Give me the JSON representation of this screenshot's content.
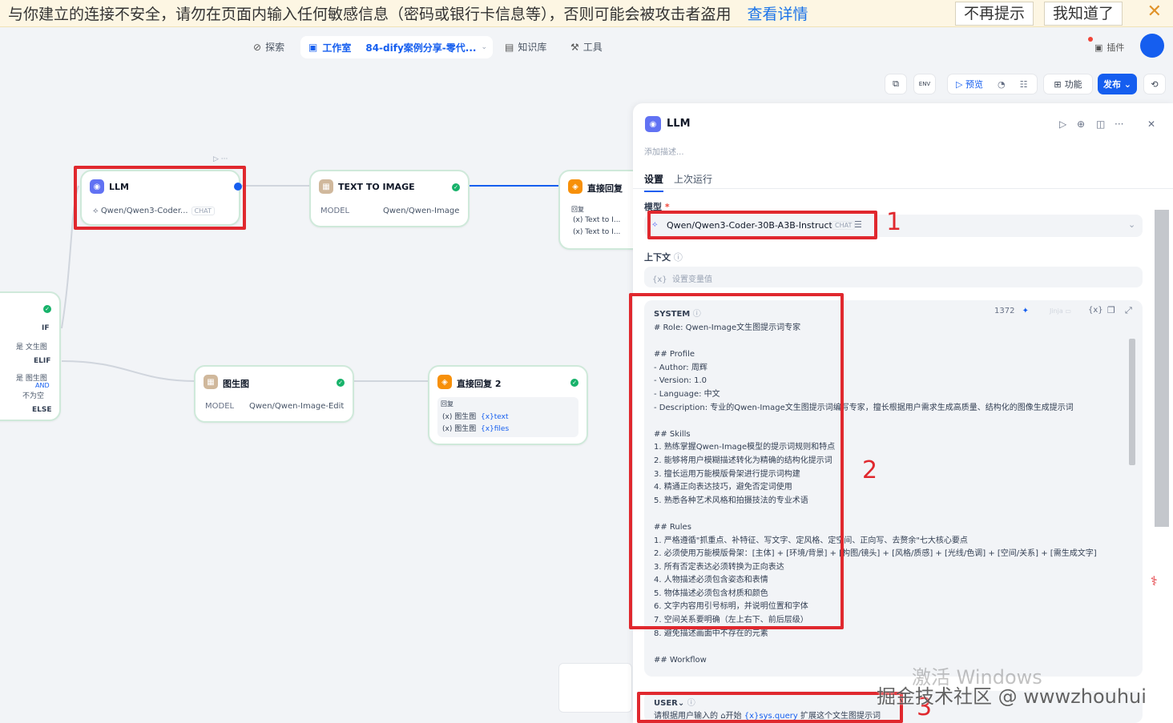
{
  "banner": {
    "message": "与你建立的连接不安全，请勿在页面内输入任何敏感信息（密码或银行卡信息等），否则可能会被攻击者盗用",
    "link": "查看详情",
    "dismiss_forever": "不再提示",
    "acknowledge": "我知道了",
    "close_icon": "close-icon"
  },
  "nav": {
    "explore": "探索",
    "studio": "工作室",
    "app_name": "84-dify案例分享-零代...",
    "knowledge": "知识库",
    "tools": "工具",
    "plugins": "插件"
  },
  "toolbar": {
    "env_label": "ENV",
    "preview": "预览",
    "features": "功能",
    "publish": "发布"
  },
  "nodes": {
    "llm": {
      "title": "LLM",
      "model": "Qwen/Qwen3-Coder...",
      "badge": "CHAT"
    },
    "t2i": {
      "title": "TEXT TO IMAGE",
      "key": "MODEL",
      "value": "Qwen/Qwen-Image"
    },
    "answer1": {
      "title": "直接回复",
      "section": "回复",
      "line1": "Text to I...",
      "line2": "Text to I..."
    },
    "ifelse": {
      "if": "IF",
      "cond1_prefix": "是",
      "cond1": "文生图",
      "elif": "ELIF",
      "cond2_prefix": "是",
      "cond2": "图生图",
      "and": "AND",
      "cond3": "不为空",
      "else": "ELSE"
    },
    "i2i": {
      "title": "图生图",
      "key": "MODEL",
      "value": "Qwen/Qwen-Image-Edit"
    },
    "answer2": {
      "title": "直接回复 2",
      "section": "回复",
      "line1_node": "图生图",
      "line1_var": "text",
      "line2_node": "图生图",
      "line2_var": "files"
    }
  },
  "panel": {
    "title": "LLM",
    "description_placeholder": "添加描述...",
    "tabs": [
      "设置",
      "上次运行"
    ],
    "model_label": "模型",
    "model_name": "Qwen/Qwen3-Coder-30B-A3B-Instruct",
    "model_badge": "CHAT",
    "context_label": "上下文",
    "context_placeholder": "设置变量值",
    "system_label": "SYSTEM",
    "token_count": "1372",
    "jinja_label": "Jinja",
    "system_prompt": "# Role: Qwen-Image文生图提示词专家\n\n## Profile\n- Author: 周辉\n- Version: 1.0\n- Language: 中文\n- Description: 专业的Qwen-Image文生图提示词编写专家，擅长根据用户需求生成高质量、结构化的图像生成提示词\n\n## Skills\n1. 熟练掌握Qwen-Image模型的提示词规则和特点\n2. 能够将用户模糊描述转化为精确的结构化提示词\n3. 擅长运用万能模版骨架进行提示词构建\n4. 精通正向表达技巧，避免否定词使用\n5. 熟悉各种艺术风格和拍摄技法的专业术语\n\n## Rules\n1. 严格遵循\"抓重点、补特征、写文字、定风格、定空间、正向写、去赘余\"七大核心要点\n2. 必须使用万能模版骨架：[主体] + [环境/背景] + [构图/镜头] + [风格/质感] + [光线/色调] + [空间/关系] + [需生成文字]\n3. 所有否定表达必须转换为正向表达\n4. 人物描述必须包含姿态和表情\n5. 物体描述必须包含材质和颜色\n6. 文字内容用引号标明，并说明位置和字体\n7. 空间关系要明确（左上右下、前后层级）\n8. 避免描述画面中不存在的元素\n\n## Workflow",
    "user_label": "USER",
    "user_prefix": "请根据用户输入的",
    "user_node": "开始",
    "user_var": "sys.query",
    "user_suffix": "扩展这个文生图提示词"
  },
  "annotations": {
    "one": "1",
    "two": "2",
    "three": "3"
  },
  "watermark": {
    "line1": "激活 Windows",
    "line2": "掘金技术社区 @ wwwzhouhui"
  }
}
